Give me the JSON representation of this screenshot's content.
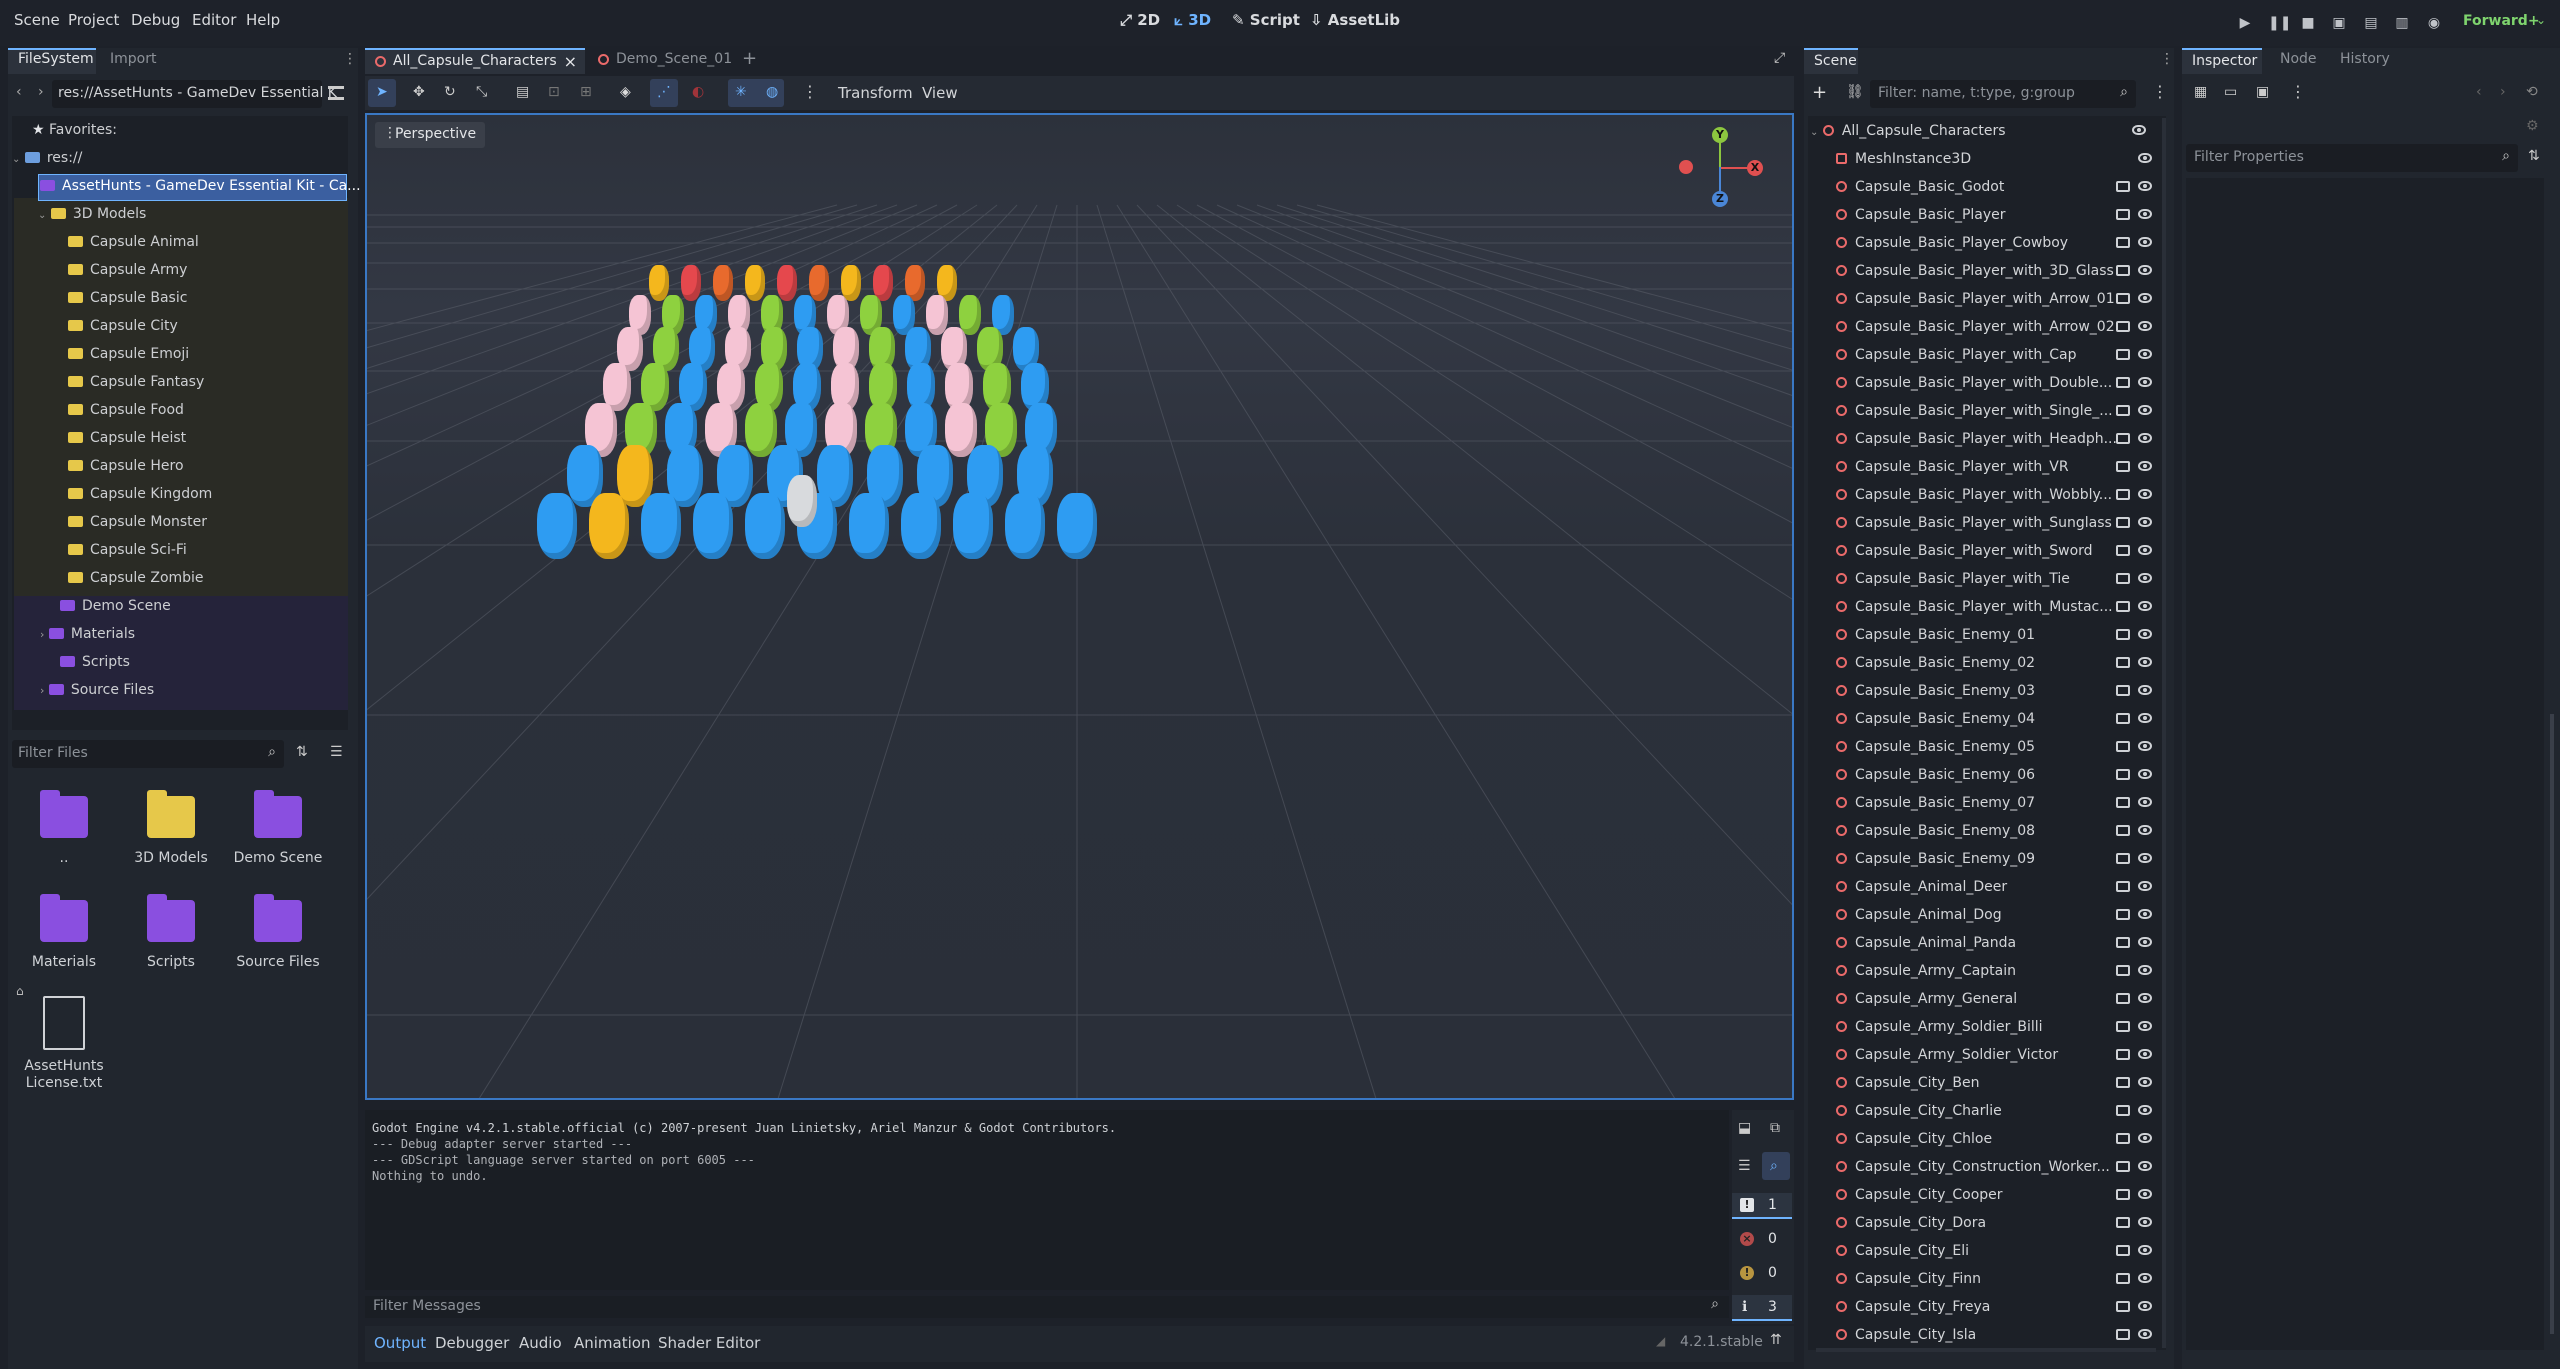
{
  "menu": [
    "Scene",
    "Project",
    "Debug",
    "Editor",
    "Help"
  ],
  "workspaces": [
    "2D",
    "3D",
    "Script",
    "AssetLib"
  ],
  "renderer": "Forward+",
  "filesystem": {
    "tabs": [
      "FileSystem",
      "Import"
    ],
    "path": "res://AssetHunts - GameDev Essential K",
    "favorites": "Favorites:",
    "root": "res://",
    "selected": "AssetHunts - GameDev Essential Kit - Ca...",
    "models_folder": "3D Models",
    "subfolders": [
      "Capsule Animal",
      "Capsule Army",
      "Capsule Basic",
      "Capsule City",
      "Capsule Emoji",
      "Capsule Fantasy",
      "Capsule Food",
      "Capsule Heist",
      "Capsule Hero",
      "Capsule Kingdom",
      "Capsule Monster",
      "Capsule Sci-Fi",
      "Capsule Zombie"
    ],
    "others": [
      "Demo Scene",
      "Materials",
      "Scripts",
      "Source Files"
    ],
    "filter_placeholder": "Filter Files",
    "tiles": [
      "..",
      "3D Models",
      "Demo Scene",
      "Materials",
      "Scripts",
      "Source Files",
      "AssetHunts License.txt"
    ]
  },
  "editor_tabs": [
    "All_Capsule_Characters",
    "Demo_Scene_01"
  ],
  "toolbar": {
    "transform": "Transform",
    "view": "View"
  },
  "viewport": {
    "perspective": "Perspective"
  },
  "scene": {
    "tab": "Scene",
    "filter_placeholder": "Filter: name, t:type, g:group",
    "root": "All_Capsule_Characters",
    "nodes": [
      "MeshInstance3D",
      "Capsule_Basic_Godot",
      "Capsule_Basic_Player",
      "Capsule_Basic_Player_Cowboy",
      "Capsule_Basic_Player_with_3D_Glass",
      "Capsule_Basic_Player_with_Arrow_01",
      "Capsule_Basic_Player_with_Arrow_02",
      "Capsule_Basic_Player_with_Cap",
      "Capsule_Basic_Player_with_Double...",
      "Capsule_Basic_Player_with_Single_...",
      "Capsule_Basic_Player_with_Headph...",
      "Capsule_Basic_Player_with_VR",
      "Capsule_Basic_Player_with_Wobbly...",
      "Capsule_Basic_Player_with_Sunglass",
      "Capsule_Basic_Player_with_Sword",
      "Capsule_Basic_Player_with_Tie",
      "Capsule_Basic_Player_with_Mustac...",
      "Capsule_Basic_Enemy_01",
      "Capsule_Basic_Enemy_02",
      "Capsule_Basic_Enemy_03",
      "Capsule_Basic_Enemy_04",
      "Capsule_Basic_Enemy_05",
      "Capsule_Basic_Enemy_06",
      "Capsule_Basic_Enemy_07",
      "Capsule_Basic_Enemy_08",
      "Capsule_Basic_Enemy_09",
      "Capsule_Animal_Deer",
      "Capsule_Animal_Dog",
      "Capsule_Animal_Panda",
      "Capsule_Army_Captain",
      "Capsule_Army_General",
      "Capsule_Army_Soldier_Billi",
      "Capsule_Army_Soldier_Victor",
      "Capsule_City_Ben",
      "Capsule_City_Charlie",
      "Capsule_City_Chloe",
      "Capsule_City_Construction_Worker...",
      "Capsule_City_Cooper",
      "Capsule_City_Dora",
      "Capsule_City_Eli",
      "Capsule_City_Finn",
      "Capsule_City_Freya",
      "Capsule_City_Isla"
    ]
  },
  "inspector": {
    "tabs": [
      "Inspector",
      "Node",
      "History"
    ],
    "filter_placeholder": "Filter Properties"
  },
  "output": {
    "lines": [
      "Godot Engine v4.2.1.stable.official (c) 2007-present Juan Linietsky, Ariel Manzur & Godot Contributors.",
      "--- Debug adapter server started ---",
      "--- GDScript language server started on port 6005 ---",
      "Nothing to undo."
    ],
    "filter_placeholder": "Filter Messages",
    "counts": [
      "1",
      "0",
      "0",
      "3"
    ],
    "version": "4.2.1.stable"
  },
  "bottom_tabs": [
    "Output",
    "Debugger",
    "Audio",
    "Animation",
    "Shader Editor"
  ],
  "gizmo": {
    "y": "Y",
    "x": "X",
    "z": "Z"
  }
}
